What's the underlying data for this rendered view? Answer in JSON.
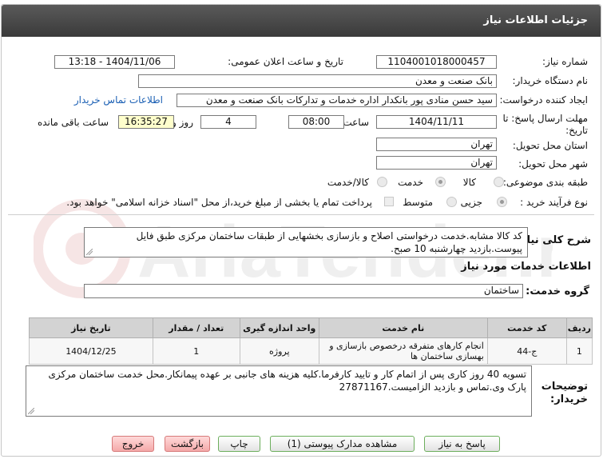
{
  "header": {
    "title": "جزئیات اطلاعات نیاز"
  },
  "form": {
    "need_number_label": "شماره نیاز:",
    "need_number": "1104001018000457",
    "announce_label": "تاریخ و ساعت اعلان عمومی:",
    "announce_value": "1404/11/06 - 13:18",
    "buyer_org_label": "نام دستگاه خریدار:",
    "buyer_org": "بانک صنعت و معدن",
    "creator_label": "ایجاد کننده درخواست:",
    "creator": "سید حسن منادی پور بانکدار اداره خدمات و تدارکات بانک صنعت و معدن",
    "contact_link": "اطلاعات تماس خریدار",
    "deadline_label": "مهلت ارسال پاسخ: تا تاریخ:",
    "deadline_date": "1404/11/11",
    "time_label": "ساعت",
    "deadline_time": "08:00",
    "days_value": "4",
    "days_label": "روز و",
    "remaining_time": "16:35:27",
    "remaining_label": "ساعت باقی مانده",
    "province_label": "استان محل تحویل:",
    "province": "تهران",
    "city_label": "شهر محل تحویل:",
    "city": "تهران",
    "category_label": "طبقه بندی موضوعی:",
    "category_options": [
      "کالا",
      "خدمت",
      "کالا/خدمت"
    ],
    "purchase_type_label": "نوع فرآیند خرید :",
    "purchase_options": [
      "جزیی",
      "متوسط"
    ],
    "payment_note": "پرداخت تمام یا بخشی از مبلغ خرید،از محل \"اسناد خزانه اسلامی\" خواهد بود."
  },
  "general_desc": {
    "label": "شرح کلی نیاز:",
    "text": "کد کالا مشابه.خدمت درخواستی اصلاح و بازسازی بخشهایی از طبقات ساختمان مرکزی طبق فایل پیوست.بازدید چهارشنبه 10 صبح."
  },
  "services": {
    "section_title": "اطلاعات خدمات مورد نیاز",
    "group_label": "گروه خدمت:",
    "group_value": "ساختمان",
    "columns": [
      "ردیف",
      "کد خدمت",
      "نام خدمت",
      "واحد اندازه گیری",
      "تعداد / مقدار",
      "تاریخ نیاز"
    ],
    "rows": [
      {
        "row": "1",
        "code": "ج-44",
        "name": "انجام کارهای متفرقه درخصوص بازسازی و بهسازی ساختمان ها",
        "unit": "پروژه",
        "qty": "1",
        "date": "1404/12/25"
      }
    ]
  },
  "buyer_notes": {
    "label": "توضیحات خریدار:",
    "text": "تسویه 40 روز کاری پس از اتمام کار و تایید کارفرما.کلیه هزینه های جانبی بر عهده پیمانکار.محل خدمت ساختمان مرکزی پارک وی.تماس و بازدید الزامیست.27871167"
  },
  "buttons": {
    "reply": "پاسخ به نیاز",
    "attachments": "مشاهده مدارک پیوستی (1)",
    "print": "چاپ",
    "back": "بازگشت",
    "exit": "خروج"
  },
  "watermark": {
    "text": "AriaTender.net"
  },
  "colors": {
    "header_bg": "#4a4a4a",
    "link": "#1a5fb4",
    "highlight_field": "#ffffcc",
    "exit_button": "#f4a9a9",
    "button_border": "#6cae5c"
  }
}
